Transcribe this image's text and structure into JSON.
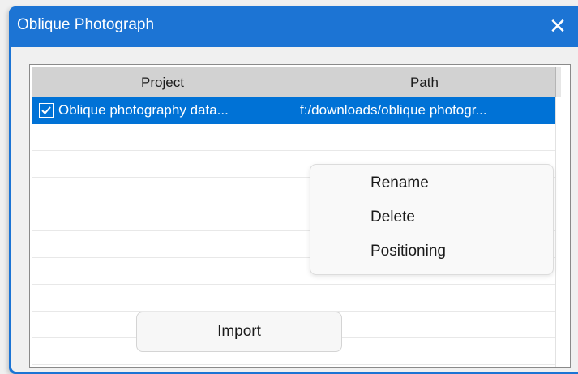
{
  "window": {
    "title": "Oblique Photograph",
    "close_symbol": "✕",
    "accent_color": "#1c74d4"
  },
  "table": {
    "columns": [
      "Project",
      "Path"
    ],
    "rows": [
      {
        "checked": true,
        "project": "Oblique photography data...",
        "path": "f:/downloads/oblique photogr..."
      }
    ],
    "selection_color": "#0072d6"
  },
  "context_menu": {
    "items": [
      "Rename",
      "Delete",
      "Positioning"
    ]
  },
  "buttons": {
    "import_label": "Import"
  },
  "icons": {
    "close": "close-icon",
    "check": "checkmark-icon"
  }
}
